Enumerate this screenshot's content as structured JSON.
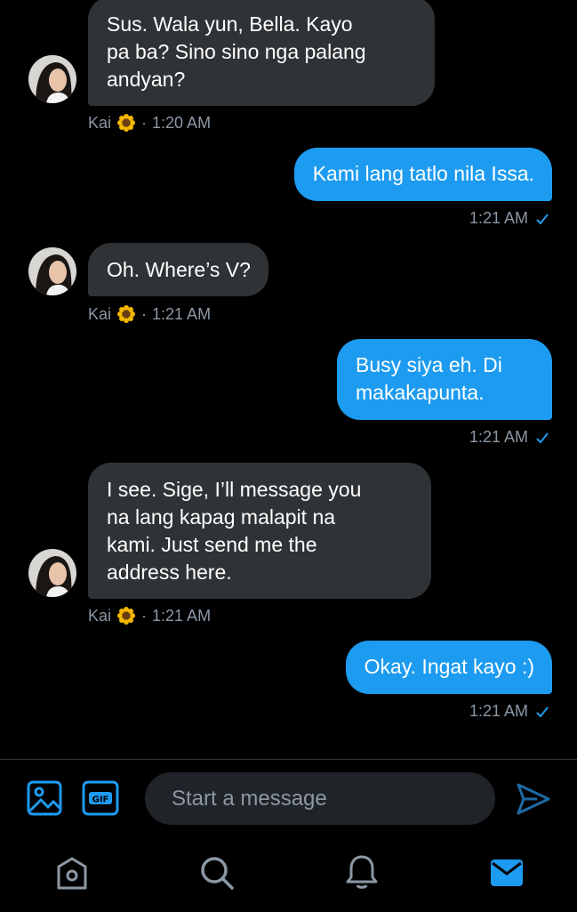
{
  "contact": {
    "name": "Kai",
    "emoji": "sunflower"
  },
  "messages": [
    {
      "dir": "in",
      "text": "Sus. Wala yun, Bella. Kayo\npa ba? Sino sino nga palang\nandyan?",
      "time": "1:20 AM"
    },
    {
      "dir": "out",
      "text": "Kami lang tatlo nila Issa.",
      "time": "1:21 AM"
    },
    {
      "dir": "in",
      "text": "Oh. Where’s V?",
      "time": "1:21 AM"
    },
    {
      "dir": "out",
      "text": "Busy siya eh. Di\nmakakapunta.",
      "time": "1:21 AM"
    },
    {
      "dir": "in",
      "text": "I see. Sige, I’ll message you\nna lang kapag malapit na\nkami. Just send me the\naddress here.",
      "time": "1:21 AM"
    },
    {
      "dir": "out",
      "text": "Okay. Ingat kayo :)",
      "time": "1:21 AM"
    }
  ],
  "meta_separator": "·",
  "composer": {
    "placeholder": "Start a message",
    "icons": [
      "image-icon",
      "gif-icon",
      "send-icon"
    ]
  },
  "bottom_nav": [
    "home-icon",
    "search-icon",
    "notifications-icon",
    "messages-icon"
  ],
  "colors": {
    "accent": "#1d9bf0",
    "incoming_bubble": "#2f3336",
    "muted": "#8b98a5",
    "background": "#000000"
  }
}
